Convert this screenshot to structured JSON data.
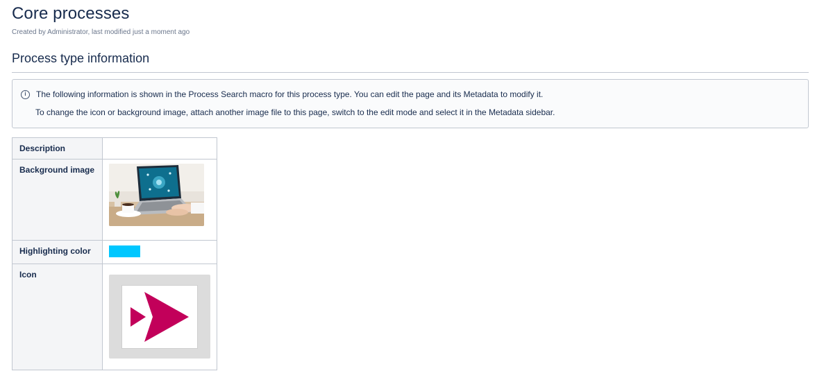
{
  "page": {
    "title": "Core processes",
    "byline": "Created by Administrator, last modified just a moment ago"
  },
  "section": {
    "heading": "Process type information"
  },
  "info_panel": {
    "icon": "info-icon",
    "line1": "The following information is shown in the Process Search macro for this process type. You can edit the page and its Metadata to modify it.",
    "line2": "To change the icon or background image, attach another image file to this page, switch to the edit mode and select it in the Metadata sidebar."
  },
  "metadata_table": {
    "description_label": "Description",
    "description_value": "",
    "background_label": "Background image",
    "background_image": "laptop-desk-photo",
    "highlight_label": "Highlighting color",
    "highlight_color": "#00c7ff",
    "icon_label": "Icon",
    "icon_image": "magenta-double-arrow-icon",
    "icon_color": "#c2005a"
  }
}
